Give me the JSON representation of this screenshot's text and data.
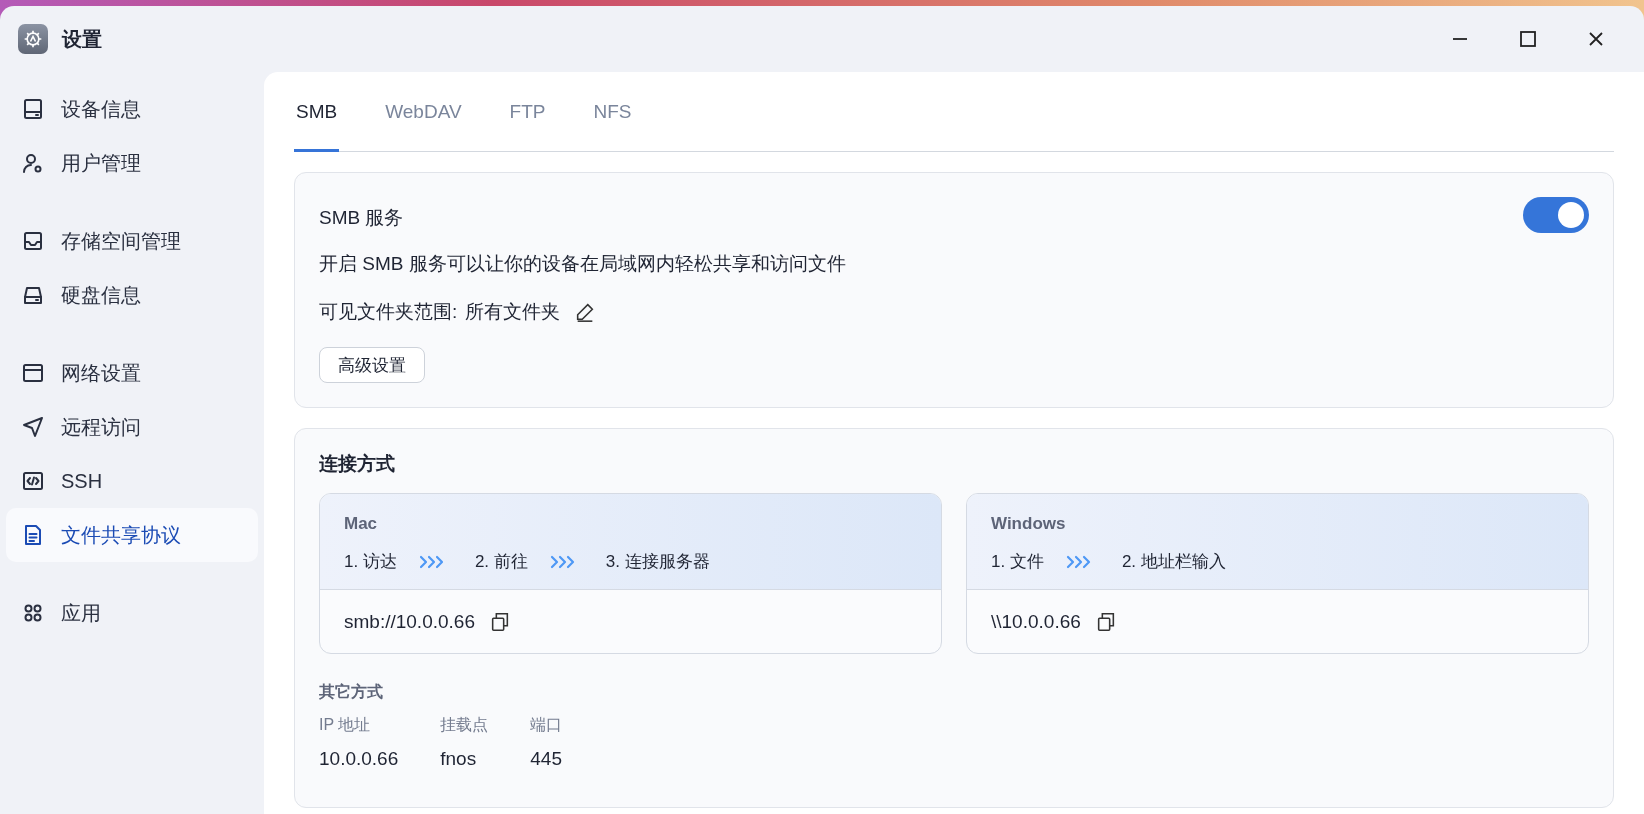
{
  "window": {
    "title": "设置"
  },
  "sidebar": {
    "groups": [
      {
        "items": [
          {
            "kind": "device",
            "label": "设备信息",
            "selected": false
          },
          {
            "kind": "user",
            "label": "用户管理",
            "selected": false
          }
        ]
      },
      {
        "items": [
          {
            "kind": "storage",
            "label": "存储空间管理",
            "selected": false
          },
          {
            "kind": "disk",
            "label": "硬盘信息",
            "selected": false
          }
        ]
      },
      {
        "items": [
          {
            "kind": "network",
            "label": "网络设置",
            "selected": false
          },
          {
            "kind": "remote",
            "label": "远程访问",
            "selected": false
          },
          {
            "kind": "ssh",
            "label": "SSH",
            "selected": false
          },
          {
            "kind": "file",
            "label": "文件共享协议",
            "selected": true
          }
        ]
      },
      {
        "items": [
          {
            "kind": "apps",
            "label": "应用",
            "selected": false
          }
        ]
      }
    ]
  },
  "tabs": [
    {
      "label": "SMB",
      "selected": true
    },
    {
      "label": "WebDAV",
      "selected": false
    },
    {
      "label": "FTP",
      "selected": false
    },
    {
      "label": "NFS",
      "selected": false
    }
  ],
  "service": {
    "title": "SMB 服务",
    "on": true,
    "description": "开启 SMB 服务可以让你的设备在局域网内轻松共享和访问文件",
    "scope_label": "可见文件夹范围:",
    "scope_value": "所有文件夹",
    "button": "高级设置"
  },
  "connection": {
    "title": "连接方式",
    "methods": [
      {
        "name": "Mac",
        "steps": [
          "1. 访达",
          "2. 前往",
          "3. 连接服务器"
        ],
        "address": "smb://10.0.0.66"
      },
      {
        "name": "Windows",
        "steps": [
          "1. 文件",
          "2. 地址栏输入"
        ],
        "address": "\\\\10.0.0.66"
      }
    ],
    "other": {
      "title": "其它方式",
      "fields": [
        {
          "label": "IP 地址",
          "value": "10.0.0.66"
        },
        {
          "label": "挂载点",
          "value": "fnos"
        },
        {
          "label": "端口",
          "value": "445"
        }
      ]
    }
  }
}
